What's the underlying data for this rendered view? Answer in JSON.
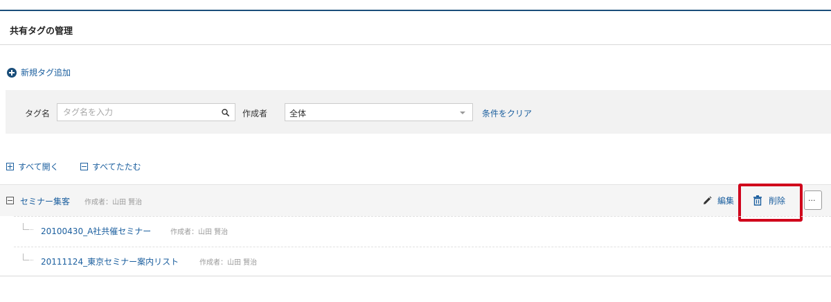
{
  "page": {
    "title": "共有タグの管理"
  },
  "actions": {
    "add_tag": "新規タグ追加"
  },
  "filter": {
    "tag_label": "タグ名",
    "tag_placeholder": "タグ名を入力",
    "creator_label": "作成者",
    "creator_value": "全体",
    "clear_label": "条件をクリア"
  },
  "tree_controls": {
    "expand_all": "すべて開く",
    "collapse_all": "すべてたたむ"
  },
  "tags": {
    "parent": {
      "name": "セミナー集客",
      "author": "作成者：山田 賢治",
      "edit_label": "編集",
      "delete_label": "削除",
      "more_label": "···"
    },
    "children": [
      {
        "name": "20100430_A社共催セミナー",
        "author": "作成者：山田 賢治"
      },
      {
        "name": "20111124_東京セミナー案内リスト",
        "author": "作成者：山田 賢治"
      }
    ]
  },
  "colors": {
    "accent": "#1a4e7a",
    "link": "#1a5e9e",
    "highlight": "#d0011b"
  }
}
